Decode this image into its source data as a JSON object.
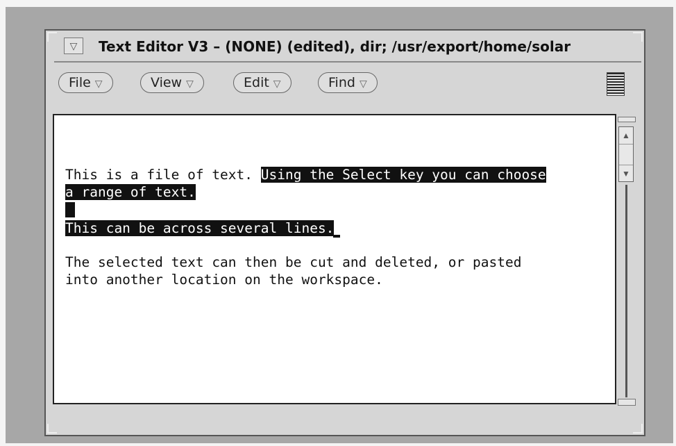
{
  "window": {
    "title": "Text Editor V3 – (NONE) (edited), dir; /usr/export/home/solar",
    "menu_button_glyph": "▽"
  },
  "menubar": {
    "items": [
      {
        "label": "File",
        "arrow": "▽"
      },
      {
        "label": "View",
        "arrow": "▽"
      },
      {
        "label": "Edit",
        "arrow": "▽"
      },
      {
        "label": "Find",
        "arrow": "▽"
      }
    ]
  },
  "editor": {
    "line1_plain": "This is a file of text. ",
    "line1_selected": "Using the Select key you can choose",
    "line2_selected": "a range of text.",
    "line4_selected": "This can be across several lines.",
    "line6": "The selected text can then be cut and deleted, or pasted",
    "line7": "into another location on the workspace."
  },
  "scrollbar": {
    "up_arrow": "▲",
    "down_arrow": "▼"
  },
  "colors": {
    "desktop": "#a7a7a7",
    "window": "#d6d6d6",
    "selection": "#111111"
  }
}
